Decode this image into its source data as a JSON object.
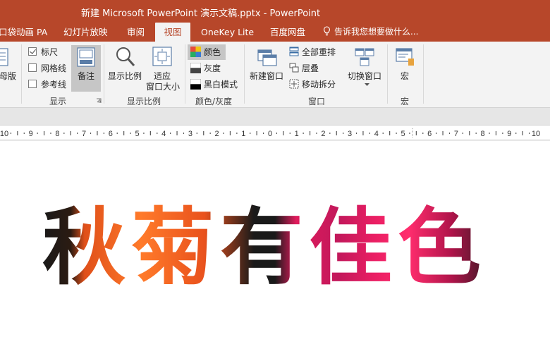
{
  "window": {
    "title": "新建 Microsoft PowerPoint 演示文稿.pptx - PowerPoint",
    "title_bar_color": "#b7472a"
  },
  "tabs": [
    {
      "label": "口袋动画 PA",
      "active": false
    },
    {
      "label": "幻灯片放映",
      "active": false
    },
    {
      "label": "审阅",
      "active": false
    },
    {
      "label": "视图",
      "active": true
    },
    {
      "label": "OneKey Lite",
      "active": false
    },
    {
      "label": "百度网盘",
      "active": false
    }
  ],
  "tell_me": {
    "label": "告诉我您想要做什么...",
    "icon": "lightbulb-icon"
  },
  "ribbon": {
    "master_views": {
      "label": "母版"
    },
    "show": {
      "group_label": "显示",
      "ruler": {
        "label": "标尺",
        "checked": true
      },
      "gridlines": {
        "label": "网格线",
        "checked": false
      },
      "guides": {
        "label": "参考线",
        "checked": false
      },
      "notes": {
        "label": "备注",
        "selected": true
      }
    },
    "zoom": {
      "group_label": "显示比例",
      "zoom_label": "显示比例",
      "fit_line1": "适应",
      "fit_line2": "窗口大小"
    },
    "color": {
      "group_label": "颜色/灰度",
      "color_label": "颜色",
      "grayscale_label": "灰度",
      "bw_label": "黑白模式"
    },
    "window": {
      "group_label": "窗口",
      "new_window_label": "新建窗口",
      "arrange_all_label": "全部重排",
      "cascade_label": "层叠",
      "move_split_label": "移动拆分",
      "switch_label": "切换窗口"
    },
    "macros": {
      "group_label": "宏",
      "macros_label": "宏"
    }
  },
  "ruler": {
    "labels": [
      "10",
      "9",
      "8",
      "7",
      "6",
      "5",
      "4",
      "3",
      "2",
      "1",
      "0",
      "1",
      "2",
      "3",
      "4",
      "5",
      "6",
      "7",
      "8",
      "9",
      "10"
    ]
  },
  "slide": {
    "text": "秋菊有佳色"
  }
}
